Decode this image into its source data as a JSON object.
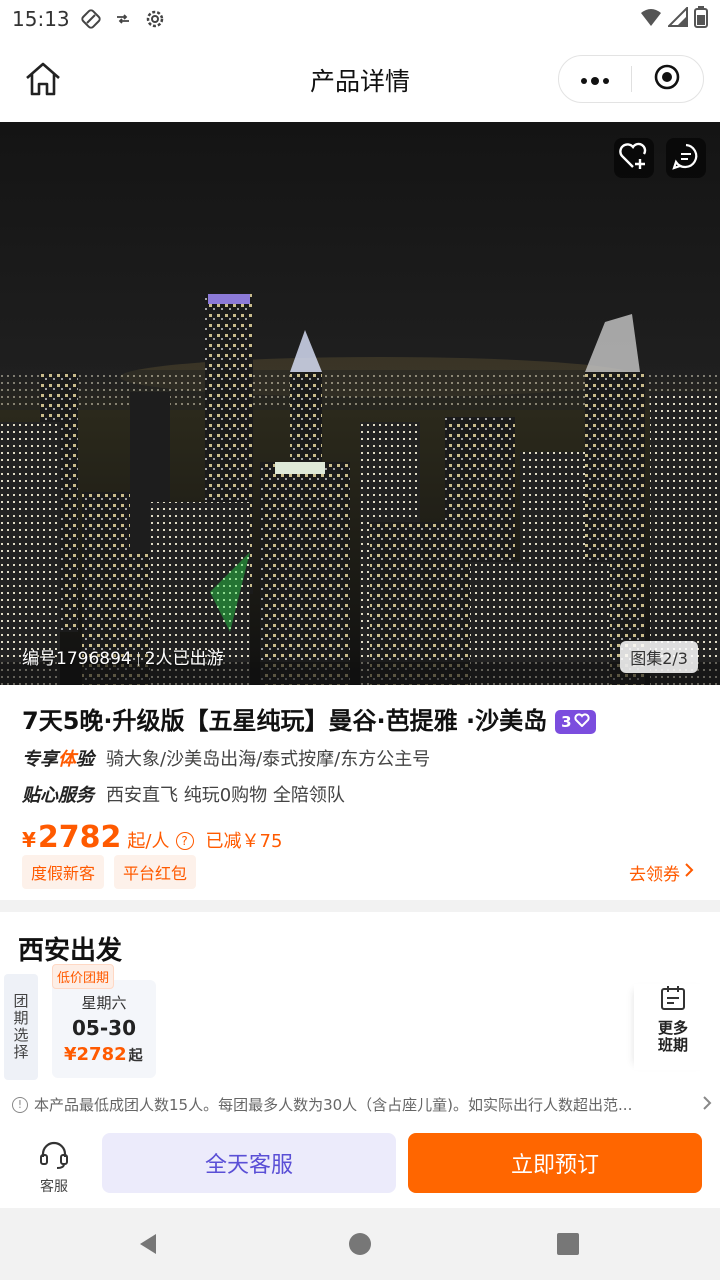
{
  "status_bar": {
    "time": "15:13",
    "icons": [
      "notification-icon",
      "data-saver-icon",
      "settings-icon",
      "wifi-icon",
      "signal-icon",
      "battery-icon"
    ]
  },
  "nav": {
    "title": "产品详情",
    "home_icon": "home-icon",
    "more_icon": "more-dots-icon",
    "close_icon": "target-close-icon"
  },
  "hero": {
    "product_code": "编号1796894",
    "traveled": "2人已出游",
    "gallery": "图集2/3",
    "fav_icon": "heart-plus-icon",
    "msg_icon": "chat-icon"
  },
  "product": {
    "title": "7天5晚·升级版【五星纯玩】曼谷·芭提雅 ·沙美岛",
    "level_badge": "3",
    "features": [
      {
        "label_a": "专享",
        "label_b": "体",
        "label_c": "验",
        "text": "骑大象/沙美岛出海/泰式按摩/东方公主号"
      },
      {
        "label_a": "贴心服务",
        "text": "西安直飞 纯玩0购物 全陪领队"
      }
    ],
    "price": {
      "symbol": "¥",
      "amount": "2782",
      "unit": "起/人",
      "help": "?",
      "reduced": "已减￥75"
    },
    "tags": [
      "度假新客",
      "平台红包"
    ],
    "coupon_link": "去领券"
  },
  "departure": {
    "title": "西安出发",
    "selector_label": "团期选择",
    "dates": [
      {
        "badge": "低价团期",
        "weekday": "星期六",
        "date": "05-30",
        "price": "¥2782",
        "suffix": "起"
      }
    ],
    "more_label_1": "更多",
    "more_label_2": "班期",
    "notice": "本产品最低成团人数15人。每团最多人数为30人（含占座儿童)。如实际出行人数超出范..."
  },
  "action_bar": {
    "service_label": "客服",
    "allday_label": "全天客服",
    "book_label": "立即预订"
  },
  "colors": {
    "accent": "#ff5a00",
    "book_button": "#ff6600",
    "allday_button_bg": "#ecebfb",
    "allday_button_text": "#5a4fd6",
    "level_badge": "#7b4dde"
  }
}
